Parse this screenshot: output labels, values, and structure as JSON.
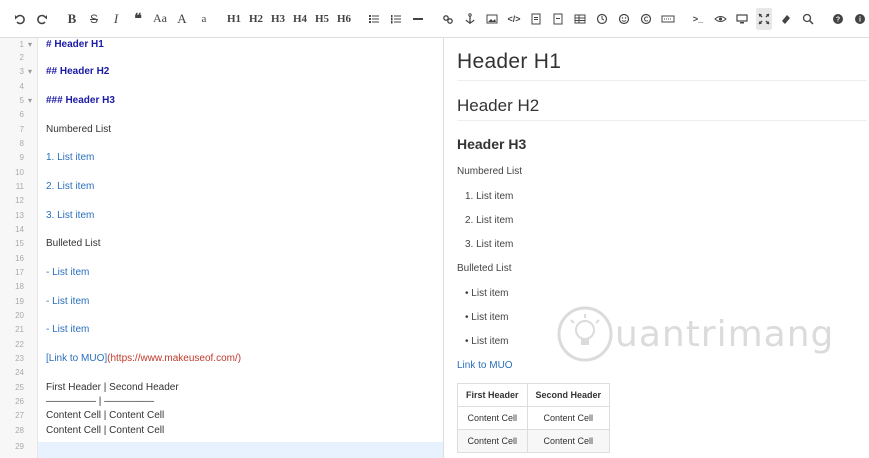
{
  "toolbar": {
    "h1": "H1",
    "h2": "H2",
    "h3": "H3",
    "h4": "H4",
    "h5": "H5",
    "h6": "H6",
    "aa_upper": "Aa",
    "a_big": "A",
    "a_small": "a",
    "quote": "❝"
  },
  "editor": {
    "lines": [
      {
        "num": "1",
        "text": "# Header H1",
        "style": "head",
        "fold": "▾"
      },
      {
        "num": "2",
        "text": "",
        "style": "plain",
        "fold": ""
      },
      {
        "num": "3",
        "text": "## Header H2",
        "style": "head",
        "fold": "▾"
      },
      {
        "num": "4",
        "text": "",
        "style": "plain",
        "fold": ""
      },
      {
        "num": "5",
        "text": "### Header H3",
        "style": "head",
        "fold": "▾"
      },
      {
        "num": "6",
        "text": "",
        "style": "plain",
        "fold": ""
      },
      {
        "num": "7",
        "text": "Numbered List",
        "style": "plain",
        "fold": ""
      },
      {
        "num": "8",
        "text": "",
        "style": "plain",
        "fold": ""
      },
      {
        "num": "9",
        "text": "1. List item",
        "style": "list",
        "fold": ""
      },
      {
        "num": "10",
        "text": "",
        "style": "plain",
        "fold": ""
      },
      {
        "num": "11",
        "text": "2. List item",
        "style": "list",
        "fold": ""
      },
      {
        "num": "12",
        "text": "",
        "style": "plain",
        "fold": ""
      },
      {
        "num": "13",
        "text": "3. List item",
        "style": "list",
        "fold": ""
      },
      {
        "num": "14",
        "text": "",
        "style": "plain",
        "fold": ""
      },
      {
        "num": "15",
        "text": "Bulleted List",
        "style": "plain",
        "fold": ""
      },
      {
        "num": "16",
        "text": "",
        "style": "plain",
        "fold": ""
      },
      {
        "num": "17",
        "text": "- List item",
        "style": "list",
        "fold": ""
      },
      {
        "num": "18",
        "text": "",
        "style": "plain",
        "fold": ""
      },
      {
        "num": "19",
        "text": "- List item",
        "style": "list",
        "fold": ""
      },
      {
        "num": "20",
        "text": "",
        "style": "plain",
        "fold": ""
      },
      {
        "num": "21",
        "text": "- List item",
        "style": "list",
        "fold": ""
      },
      {
        "num": "22",
        "text": "",
        "style": "plain",
        "fold": ""
      },
      {
        "num": "23",
        "text": "",
        "style": "linkline",
        "fold": "",
        "link": "[Link to MUO]",
        "url": "(https://www.makeuseof.com/)"
      },
      {
        "num": "24",
        "text": "",
        "style": "plain",
        "fold": ""
      },
      {
        "num": "25",
        "text": "First Header  | Second Header",
        "style": "plain",
        "fold": ""
      },
      {
        "num": "26",
        "text": "————— | —————",
        "style": "plain",
        "fold": ""
      },
      {
        "num": "27",
        "text": "Content Cell  | Content Cell",
        "style": "plain",
        "fold": ""
      },
      {
        "num": "28",
        "text": "Content Cell  | Content Cell",
        "style": "plain",
        "fold": ""
      },
      {
        "num": "29",
        "text": "",
        "style": "plain",
        "fold": ""
      }
    ]
  },
  "preview": {
    "h1": "Header H1",
    "h2": "Header H2",
    "h3": "Header H3",
    "numbered_title": "Numbered List",
    "numbered_items": [
      "1. List item",
      "2. List item",
      "3. List item"
    ],
    "bulleted_title": "Bulleted List",
    "bulleted_items": [
      "List item",
      "List item",
      "List item"
    ],
    "link_text": "Link to MUO",
    "table": {
      "headers": [
        "First Header",
        "Second Header"
      ],
      "rows": [
        [
          "Content Cell",
          "Content Cell"
        ],
        [
          "Content Cell",
          "Content Cell"
        ]
      ]
    }
  },
  "watermark": {
    "text": "uantrimang"
  },
  "colors": {
    "heading_markup": "#1a1aa6",
    "list_markup": "#2a6fbd",
    "url": "#c0392b",
    "active_line": "#e8f2ff"
  }
}
